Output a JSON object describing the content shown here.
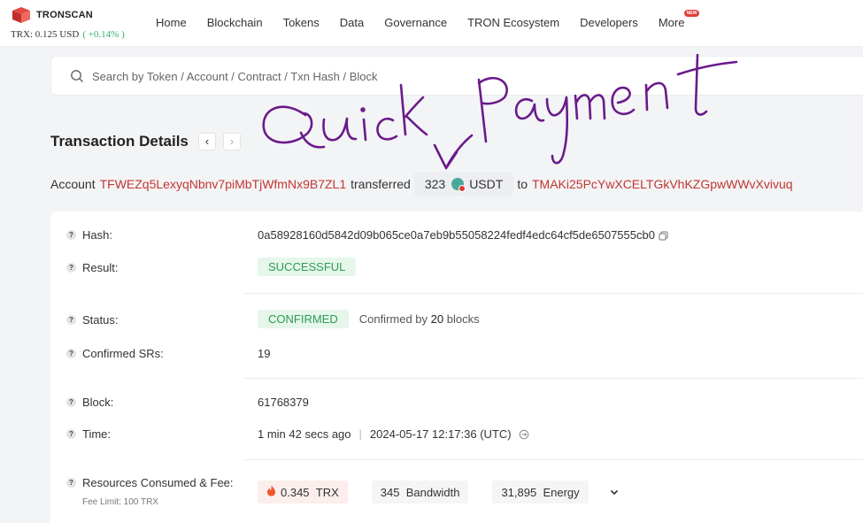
{
  "header": {
    "brand": "TRONSCAN",
    "price_label": "TRX: 0.125 USD",
    "price_change": "( +0.14% )",
    "nav": [
      "Home",
      "Blockchain",
      "Tokens",
      "Data",
      "Governance",
      "TRON Ecosystem",
      "Developers",
      "More"
    ],
    "new_badge": "NEW"
  },
  "search": {
    "placeholder": "Search by Token / Account / Contract / Txn Hash / Block"
  },
  "page": {
    "title": "Transaction Details",
    "prev": "‹",
    "next": "›"
  },
  "summary": {
    "prefix": "Account",
    "from": "TFWEZq5LexyqNbnv7piMbTjWfmNx9B7ZL1",
    "verb": "transferred",
    "amount": "323",
    "token": "USDT",
    "to_word": "to",
    "to": "TMAKi25PcYwXCELTGkVhKZGpwWWvXvivuq"
  },
  "details": {
    "hash_label": "Hash:",
    "hash": "0a58928160d5842d09b065ce0a7eb9b55058224fedf4edc64cf5de6507555cb0",
    "result_label": "Result:",
    "result": "SUCCESSFUL",
    "status_label": "Status:",
    "status": "CONFIRMED",
    "confirmed_by_prefix": "Confirmed by",
    "confirmed_by_count": "20",
    "confirmed_by_suffix": "blocks",
    "srs_label": "Confirmed SRs:",
    "srs": "19",
    "block_label": "Block:",
    "block": "61768379",
    "time_label": "Time:",
    "time_ago": "1 min 42 secs ago",
    "time_utc": "2024-05-17 12:17:36 (UTC)",
    "resources_label": "Resources Consumed & Fee:",
    "fee_limit": "Fee Limit: 100 TRX",
    "fee_trx_value": "0.345",
    "fee_trx_unit": "TRX",
    "bandwidth_value": "345",
    "bandwidth_unit": "Bandwidth",
    "energy_value": "31,895",
    "energy_unit": "Energy"
  },
  "annotation": {
    "handwritten_text": "Quick Payment",
    "color": "#6a1b8a"
  },
  "colors": {
    "address": "#c23631",
    "success_bg": "#e6f6ea",
    "success_text": "#2e9b55",
    "price_up": "#2db36f"
  }
}
